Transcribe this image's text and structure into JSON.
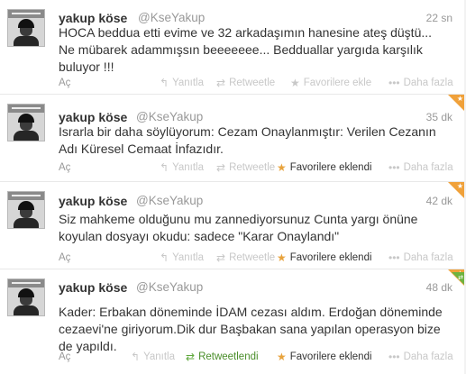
{
  "tweets": [
    {
      "name": "yakup köse",
      "handle": "@KseYakup",
      "time": "22 sn",
      "text": [
        "HOCA beddua etti evime ve 32 arkadaşımın hanesine ateş düştü...",
        "Ne mübarek adammışsın beeeeeee... Bedduallar yargıda karşılık",
        "buluyor !!!"
      ],
      "expand": "Aç",
      "actions": {
        "reply": "Yanıtla",
        "retweet": "Retweetle",
        "favorite": "Favorilere ekle",
        "more": "Daha fazla"
      },
      "favorited": false,
      "retweeted": false
    },
    {
      "name": "yakup köse",
      "handle": "@KseYakup",
      "time": "35 dk",
      "text": [
        "Israrla bir daha söylüyorum: Cezam Onaylanmıştır: Verilen Cezanın",
        "Adı Küresel Cemaat İnfazıdır."
      ],
      "expand": "Aç",
      "actions": {
        "reply": "Yanıtla",
        "retweet": "Retweetle",
        "favorite": "Favorilere eklendi",
        "more": "Daha fazla"
      },
      "favorited": true,
      "retweeted": false
    },
    {
      "name": "yakup köse",
      "handle": "@KseYakup",
      "time": "42 dk",
      "text": [
        "Siz mahkeme olduğunu mu zannediyorsunuz Cunta yargı önüne",
        "koyulan dosyayı okudu: sadece \"Karar Onaylandı\""
      ],
      "expand": "Aç",
      "actions": {
        "reply": "Yanıtla",
        "retweet": "Retweetle",
        "favorite": "Favorilere eklendi",
        "more": "Daha fazla"
      },
      "favorited": true,
      "retweeted": false
    },
    {
      "name": "yakup köse",
      "handle": "@KseYakup",
      "time": "48 dk",
      "text": [
        "Kader: Erbakan döneminde İDAM cezası aldım. Erdoğan döneminde",
        "cezaevi'ne giriyorum.Dik dur Başbakan sana yapılan operasyon bize",
        "de yapıldı."
      ],
      "expand": "Aç",
      "actions": {
        "reply": "Yanıtla",
        "retweet": "Retweetlendi",
        "favorite": "Favorilere eklendi",
        "more": "Daha fazla"
      },
      "favorited": true,
      "retweeted": true
    }
  ],
  "icons": {
    "reply": "reply-arrow-icon",
    "retweet": "retweet-icon",
    "favorite": "star-icon",
    "more": "ellipsis-icon"
  },
  "colors": {
    "favorite_active": "#e8a33d",
    "retweet_active": "#5ea83a",
    "corner_favorite": "#f0a13a",
    "corner_retweet": "#6db33f",
    "muted": "#c8c8c8"
  }
}
